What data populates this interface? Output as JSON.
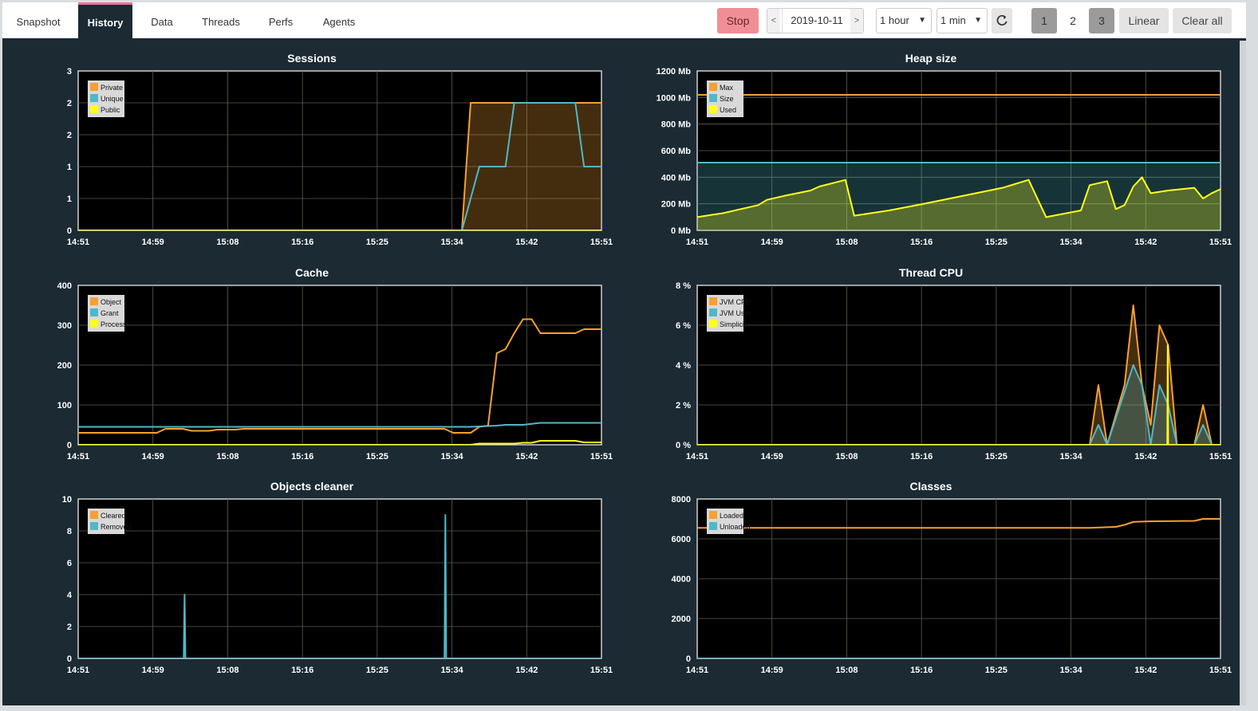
{
  "tabs": [
    "Snapshot",
    "History",
    "Data",
    "Threads",
    "Perfs",
    "Agents"
  ],
  "active_tab": "History",
  "toolbar": {
    "stop_label": "Stop",
    "date_prev": "<",
    "date_value": "2019-10-11",
    "date_next": ">",
    "period_value": "1 hour",
    "interval_value": "1 min",
    "refresh_icon": "refresh-icon",
    "layout_1": "1",
    "layout_2": "2",
    "layout_3": "3",
    "linear_label": "Linear",
    "clear_label": "Clear all"
  },
  "colors": {
    "orange": "#f5a031",
    "cyan": "#4fb8c8",
    "yellow": "#ffff1a",
    "bg": "#1b2a33",
    "plot": "#000000"
  },
  "time_ticks": [
    "14:51",
    "14:59",
    "15:08",
    "15:16",
    "15:25",
    "15:34",
    "15:42",
    "15:51"
  ],
  "chart_data": [
    {
      "type": "area",
      "title": "Sessions",
      "yticks": [
        "0",
        "1",
        "1",
        "2",
        "2",
        "3"
      ],
      "ylim": [
        0,
        2.5
      ],
      "legend_pos": "top-left",
      "series": [
        {
          "name": "Private",
          "color": "#f5a031",
          "fill": true,
          "points": [
            [
              0,
              0
            ],
            [
              44,
              0
            ],
            [
              45,
              2
            ],
            [
              60,
              2
            ]
          ]
        },
        {
          "name": "Unique",
          "color": "#4fb8c8",
          "fill": false,
          "points": [
            [
              0,
              0
            ],
            [
              44,
              0
            ],
            [
              46,
              1
            ],
            [
              49,
              1
            ],
            [
              50,
              2
            ],
            [
              57,
              2
            ],
            [
              58,
              1
            ],
            [
              60,
              1
            ]
          ]
        },
        {
          "name": "Public",
          "color": "#ffff1a",
          "fill": false,
          "points": [
            [
              0,
              0
            ],
            [
              60,
              0
            ]
          ]
        }
      ]
    },
    {
      "type": "area",
      "title": "Heap size",
      "yticks": [
        "0 Mb",
        "200 Mb",
        "400 Mb",
        "600 Mb",
        "800 Mb",
        "1000 Mb",
        "1200 Mb"
      ],
      "ylim": [
        0,
        1200
      ],
      "legend_pos": "top-left",
      "series": [
        {
          "name": "Max",
          "color": "#f5a031",
          "fill": false,
          "points": [
            [
              0,
              1020
            ],
            [
              60,
              1020
            ]
          ]
        },
        {
          "name": "Size",
          "color": "#4fb8c8",
          "fill": true,
          "points": [
            [
              0,
              510
            ],
            [
              60,
              510
            ]
          ]
        },
        {
          "name": "Used",
          "color": "#ffff1a",
          "fill": true,
          "points": [
            [
              0,
              100
            ],
            [
              3,
              130
            ],
            [
              7,
              190
            ],
            [
              8,
              230
            ],
            [
              10,
              260
            ],
            [
              13,
              300
            ],
            [
              14,
              330
            ],
            [
              17,
              380
            ],
            [
              18,
              110
            ],
            [
              22,
              150
            ],
            [
              26,
              200
            ],
            [
              35,
              320
            ],
            [
              38,
              380
            ],
            [
              40,
              100
            ],
            [
              44,
              150
            ],
            [
              45,
              340
            ],
            [
              47,
              370
            ],
            [
              48,
              160
            ],
            [
              49,
              190
            ],
            [
              50,
              330
            ],
            [
              51,
              400
            ],
            [
              52,
              280
            ],
            [
              54,
              300
            ],
            [
              57,
              320
            ],
            [
              58,
              240
            ],
            [
              59,
              280
            ],
            [
              60,
              310
            ]
          ]
        }
      ]
    },
    {
      "type": "line",
      "title": "Cache",
      "yticks": [
        "0",
        "100",
        "200",
        "300",
        "400"
      ],
      "ylim": [
        0,
        400
      ],
      "legend_pos": "top-left",
      "series": [
        {
          "name": "Object",
          "color": "#f5a031",
          "fill": false,
          "points": [
            [
              0,
              30
            ],
            [
              9,
              30
            ],
            [
              10,
              40
            ],
            [
              12,
              40
            ],
            [
              13,
              35
            ],
            [
              15,
              35
            ],
            [
              16,
              38
            ],
            [
              18,
              38
            ],
            [
              19,
              40
            ],
            [
              42,
              40
            ],
            [
              43,
              30
            ],
            [
              45,
              30
            ],
            [
              46,
              45
            ],
            [
              47,
              48
            ],
            [
              48,
              230
            ],
            [
              49,
              240
            ],
            [
              50,
              280
            ],
            [
              51,
              315
            ],
            [
              52,
              315
            ],
            [
              53,
              280
            ],
            [
              57,
              280
            ],
            [
              58,
              290
            ],
            [
              60,
              290
            ]
          ]
        },
        {
          "name": "Grant",
          "color": "#4fb8c8",
          "fill": false,
          "points": [
            [
              0,
              45
            ],
            [
              45,
              45
            ],
            [
              48,
              48
            ],
            [
              49,
              50
            ],
            [
              51,
              50
            ],
            [
              53,
              55
            ],
            [
              60,
              55
            ]
          ]
        },
        {
          "name": "Process",
          "color": "#ffff1a",
          "fill": false,
          "points": [
            [
              0,
              0
            ],
            [
              45,
              0
            ],
            [
              46,
              3
            ],
            [
              50,
              3
            ],
            [
              51,
              5
            ],
            [
              52,
              5
            ],
            [
              53,
              10
            ],
            [
              57,
              10
            ],
            [
              58,
              6
            ],
            [
              60,
              6
            ]
          ]
        }
      ]
    },
    {
      "type": "area",
      "title": "Thread CPU",
      "yticks": [
        "0 %",
        "2 %",
        "4 %",
        "6 %",
        "8 %"
      ],
      "ylim": [
        0,
        8
      ],
      "legend_pos": "top-left",
      "series": [
        {
          "name": "JVM CPU",
          "color": "#f5a031",
          "fill": true,
          "points": [
            [
              0,
              0
            ],
            [
              45,
              0
            ],
            [
              46,
              3
            ],
            [
              47,
              0
            ],
            [
              49,
              3
            ],
            [
              50,
              7
            ],
            [
              51,
              3
            ],
            [
              52,
              1
            ],
            [
              53,
              6
            ],
            [
              54,
              5
            ],
            [
              55,
              0
            ],
            [
              57,
              0
            ],
            [
              58,
              2
            ],
            [
              59,
              0
            ],
            [
              60,
              0
            ]
          ]
        },
        {
          "name": "JVM User",
          "color": "#4fb8c8",
          "fill": true,
          "points": [
            [
              0,
              0
            ],
            [
              45,
              0
            ],
            [
              46,
              1
            ],
            [
              47,
              0
            ],
            [
              50,
              4
            ],
            [
              51,
              3
            ],
            [
              52,
              0
            ],
            [
              53,
              3
            ],
            [
              54,
              2
            ],
            [
              55,
              0
            ],
            [
              57,
              0
            ],
            [
              58,
              1
            ],
            [
              59,
              0
            ],
            [
              60,
              0
            ]
          ]
        },
        {
          "name": "Simplicite",
          "color": "#ffff1a",
          "fill": false,
          "points": [
            [
              0,
              0
            ],
            [
              53.9,
              0
            ],
            [
              53.95,
              5
            ],
            [
              54,
              0
            ],
            [
              60,
              0
            ]
          ]
        }
      ]
    },
    {
      "type": "bar",
      "title": "Objects cleaner",
      "yticks": [
        "0",
        "2",
        "4",
        "6",
        "8",
        "10"
      ],
      "ylim": [
        0,
        10
      ],
      "legend_pos": "top-left",
      "series": [
        {
          "name": "Cleared",
          "color": "#f5a031",
          "fill": false,
          "points": [
            [
              0,
              0
            ],
            [
              60,
              0
            ]
          ]
        },
        {
          "name": "Removed",
          "color": "#4fb8c8",
          "fill": false,
          "points": [
            [
              0,
              0
            ],
            [
              12.1,
              0
            ],
            [
              12.2,
              4
            ],
            [
              12.3,
              0
            ],
            [
              42.0,
              0
            ],
            [
              42.1,
              9
            ],
            [
              42.2,
              0
            ],
            [
              60,
              0
            ]
          ]
        }
      ]
    },
    {
      "type": "line",
      "title": "Classes",
      "yticks": [
        "0",
        "2000",
        "4000",
        "6000",
        "8000"
      ],
      "ylim": [
        0,
        8000
      ],
      "legend_pos": "top-left",
      "series": [
        {
          "name": "Loaded",
          "color": "#f5a031",
          "fill": false,
          "points": [
            [
              0,
              6550
            ],
            [
              45,
              6550
            ],
            [
              48,
              6600
            ],
            [
              49,
              6700
            ],
            [
              50,
              6850
            ],
            [
              52,
              6880
            ],
            [
              57,
              6900
            ],
            [
              58,
              7000
            ],
            [
              60,
              7000
            ]
          ]
        },
        {
          "name": "Unloaded",
          "color": "#4fb8c8",
          "fill": false,
          "points": [
            [
              0,
              0
            ],
            [
              60,
              0
            ]
          ]
        }
      ]
    }
  ]
}
